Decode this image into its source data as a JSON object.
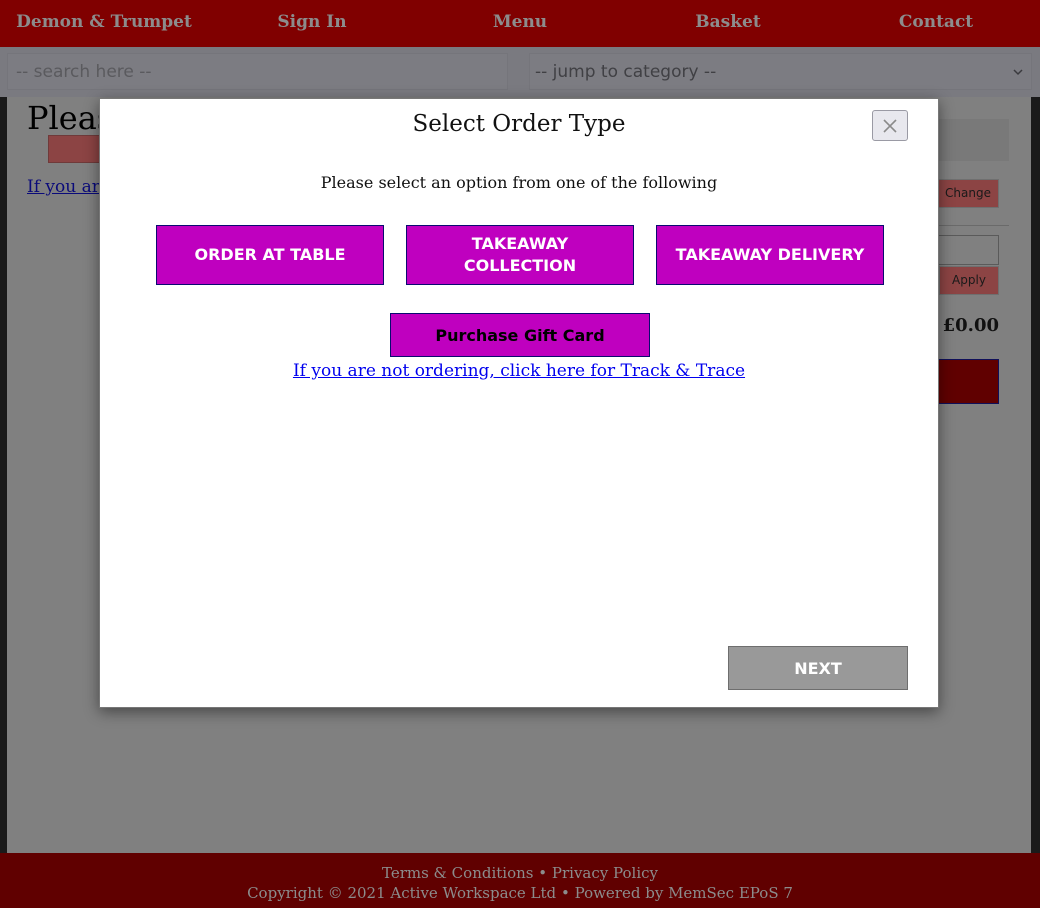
{
  "nav": {
    "items": [
      {
        "label": "Demon & Trumpet"
      },
      {
        "label": "Sign In"
      },
      {
        "label": "Menu"
      },
      {
        "label": "Basket"
      },
      {
        "label": "Contact"
      }
    ]
  },
  "search": {
    "placeholder": "-- search here --",
    "value": ""
  },
  "category_select": {
    "selected": "-- jump to category --",
    "icon": "chevron-down-icon"
  },
  "background_page": {
    "heading": "Pleas",
    "link_text": "If you ar",
    "change_label": "Change",
    "apply_label": "Apply",
    "total": "£0.00"
  },
  "modal": {
    "title": "Select Order Type",
    "close_icon": "close-icon",
    "subtitle": "Please select an option from one of the following",
    "options": [
      {
        "label": "ORDER AT TABLE"
      },
      {
        "label": "TAKEAWAY COLLECTION"
      },
      {
        "label": "TAKEAWAY DELIVERY"
      }
    ],
    "gift_card_label": "Purchase Gift Card",
    "track_trace_link": "If you are not ordering, click here for Track & Trace",
    "next_label": "NEXT"
  },
  "footer": {
    "terms": "Terms & Conditions",
    "separator": "•",
    "privacy": "Privacy Policy",
    "copyright": "Copyright © 2021 Active Workspace Ltd",
    "powered_by": "Powered by MemSec EPoS 7"
  },
  "colors": {
    "brand": "#800000",
    "option_button": "#bf00bf",
    "next_button": "#999999",
    "link": "#0000ee"
  }
}
